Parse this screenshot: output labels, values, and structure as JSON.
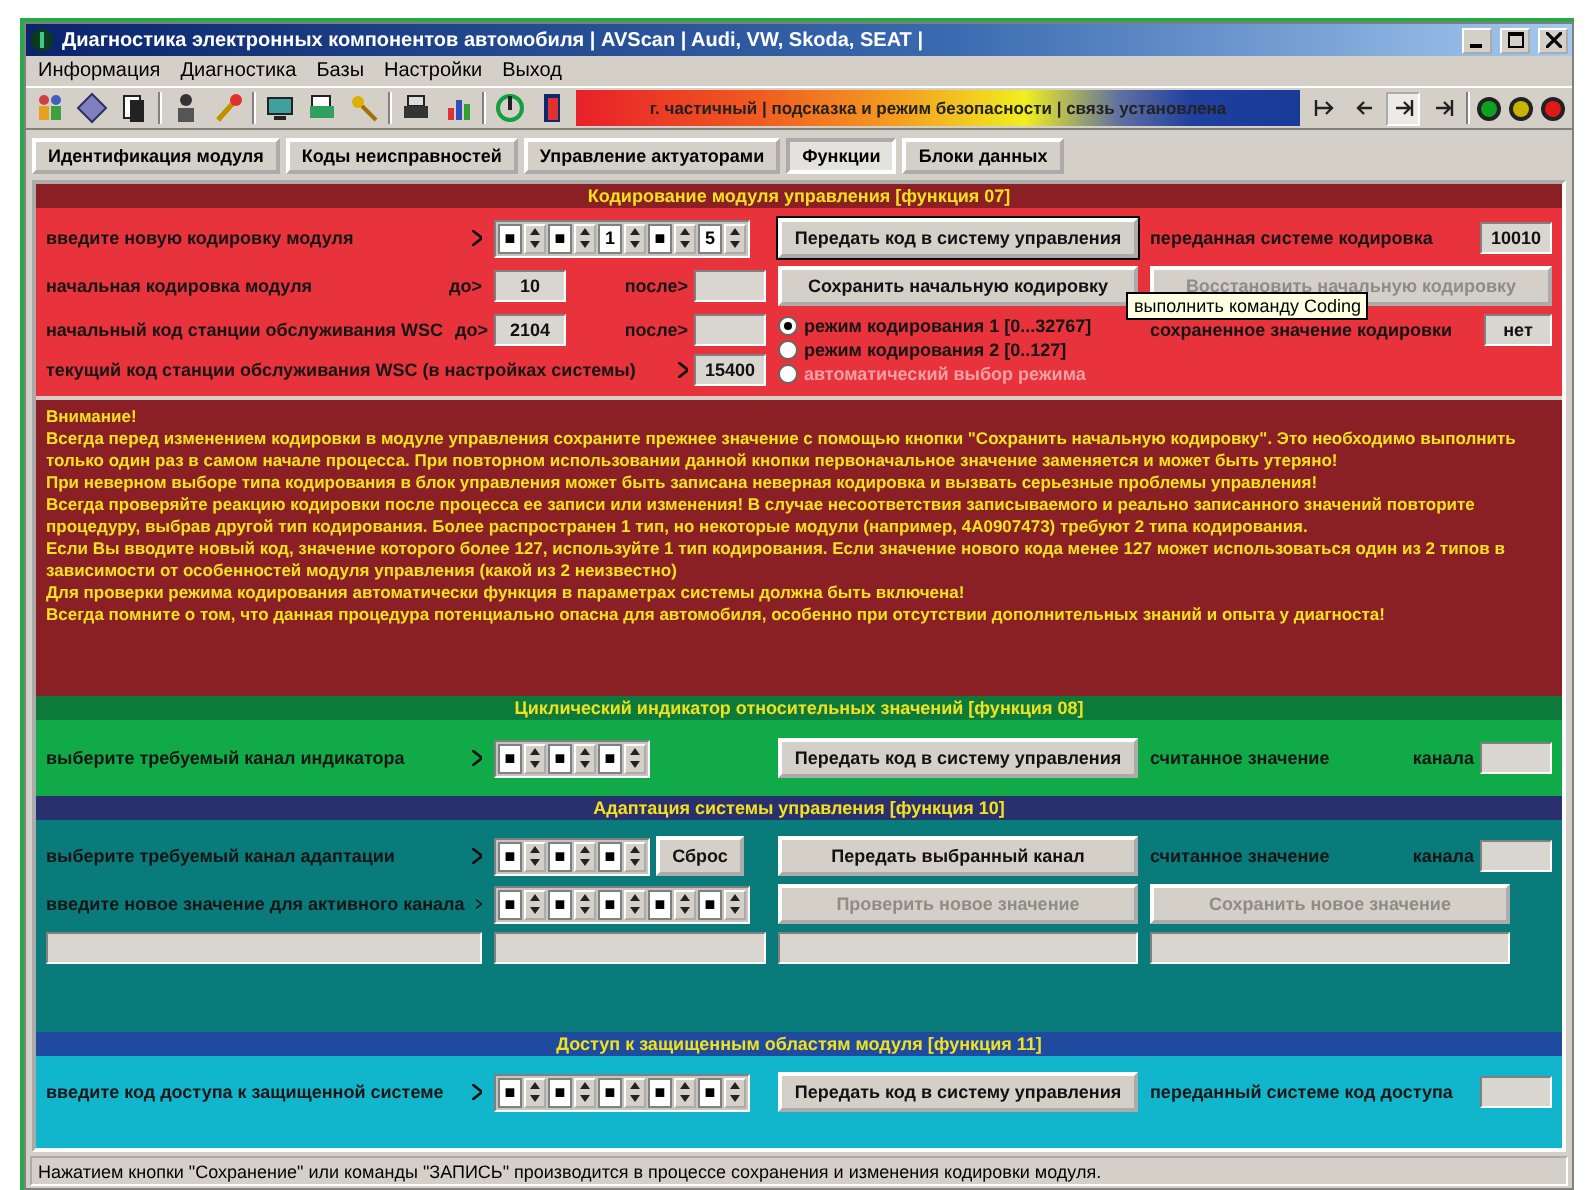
{
  "window": {
    "title": "Диагностика электронных компонентов автомобиля | AVScan | Audi, VW, Skoda, SEAT |"
  },
  "menu": [
    "Информация",
    "Диагностика",
    "Базы",
    "Настройки",
    "Выход"
  ],
  "status_banner": "г. частичный | подсказка и режим безопасности | связь установлена",
  "nav_buttons": [
    {
      "kind": "first",
      "selected": false
    },
    {
      "kind": "prev",
      "selected": false
    },
    {
      "kind": "next",
      "selected": true
    },
    {
      "kind": "last",
      "selected": false
    }
  ],
  "lights": [
    {
      "color": "#10a020"
    },
    {
      "color": "#c8b400"
    },
    {
      "color": "#e01818"
    }
  ],
  "tabs": [
    {
      "label": "Идентификация модуля",
      "selected": false
    },
    {
      "label": "Коды неисправностей",
      "selected": false
    },
    {
      "label": "Управление актуаторами",
      "selected": false
    },
    {
      "label": "Функции",
      "selected": true
    },
    {
      "label": "Блоки данных",
      "selected": false
    }
  ],
  "coding": {
    "title": "Кодирование модуля управления [функция 07]",
    "new_code": {
      "label": "введите новую кодировку модуля",
      "digits": [
        "■",
        "■",
        "1",
        "■",
        "5"
      ]
    },
    "send_button": "Передать код в систему управления",
    "sent": {
      "label": "переданная системе кодировка",
      "value": "10010"
    },
    "initial": {
      "label": "начальная кодировка модуля",
      "before_label": "до>",
      "before_value": "10",
      "after_label": "после>"
    },
    "save_button": "Сохранить начальную кодировку",
    "restore_button": {
      "label": "Восстановить начальную кодировку",
      "disabled": true
    },
    "tooltip": "выполнить команду Coding",
    "wsc_initial": {
      "label": "начальный код станции обслуживания WSC",
      "before_label": "до>",
      "before_value": "2104",
      "after_label": "после>"
    },
    "modes": [
      {
        "label": "режим кодирования 1 [0...32767]",
        "selected": true,
        "disabled": false
      },
      {
        "label": "режим кодирования 2 [0..127]",
        "selected": false,
        "disabled": false
      },
      {
        "label": "автоматический выбор режима",
        "selected": false,
        "disabled": true
      }
    ],
    "stored": {
      "label": "сохраненное значение кодировки",
      "value": "нет"
    },
    "wsc_current": {
      "label": "текущий код станции обслуживания WSC (в настройках системы)",
      "value": "15400"
    }
  },
  "warning": {
    "title": "Внимание!",
    "lines": [
      "Всегда перед изменением кодировки в модуле управления сохраните прежнее значение с помощью кнопки \"Сохранить начальную кодировку\". Это необходимо выполнить только один раз в самом начале процесса. При повторном использовании данной кнопки первоначальное значение заменяется и может быть утеряно!",
      "При неверном выборе типа кодирования в блок управления может быть записана неверная кодировка и вызвать серьезные проблемы управления!",
      "Всегда проверяйте реакцию кодировки после процесса ее записи или изменения! В случае несоответствия записываемого и реально записанного значений повторите процедуру, выбрав другой тип кодирования. Более распространен 1 тип, но некоторые модули (например, 4A0907473) требуют 2 типа кодирования.",
      "Если Вы вводите новый код, значение которого более 127, используйте 1 тип кодирования. Если значение нового кода менее 127 может использоваться один из 2 типов в зависимости от особенностей модуля управления (какой из 2 неизвестно)",
      "Для проверки режима кодирования автоматически функция в параметрах системы должна быть включена!",
      "Всегда помните о том, что данная процедура потенциально опасна для автомобиля, особенно при отсутствии дополнительных знаний и опыта у диагноста!"
    ]
  },
  "indicator": {
    "title": "Циклический индикатор относительных значений [функция 08]",
    "channel": {
      "label": "выберите требуемый канал индикатора",
      "digits": [
        "■",
        "■",
        "■"
      ]
    },
    "send_button": "Передать код в систему управления",
    "read_label": "считанное значение",
    "channel_label": "канала"
  },
  "adaptation": {
    "title": "Адаптация системы управления [функция 10]",
    "channel": {
      "label": "выберите требуемый канал адаптации",
      "digits": [
        "■",
        "■",
        "■"
      ]
    },
    "reset_button": "Сброс",
    "send_button": "Передать выбранный канал",
    "read_label": "считанное значение",
    "channel_label": "канала",
    "new_value": {
      "label": "введите новое значение для активного канала",
      "digits": [
        "■",
        "■",
        "■",
        "■",
        "■"
      ]
    },
    "check_button": {
      "label": "Проверить новое значение",
      "disabled": true
    },
    "save_button": {
      "label": "Сохранить новое значение",
      "disabled": true
    }
  },
  "access": {
    "title": "Доступ к защищенным областям модуля [функция 11]",
    "code": {
      "label": "введите код доступа к защищенной системе",
      "digits": [
        "■",
        "■",
        "■",
        "■",
        "■"
      ]
    },
    "send_button": "Передать код в систему управления",
    "sent_label": "переданный системе код доступа"
  },
  "status_bar": "Нажатием кнопки \"Сохранение\" или команды \"ЗАПИСЬ\" производится в процессе сохранения и изменения кодировки модуля."
}
